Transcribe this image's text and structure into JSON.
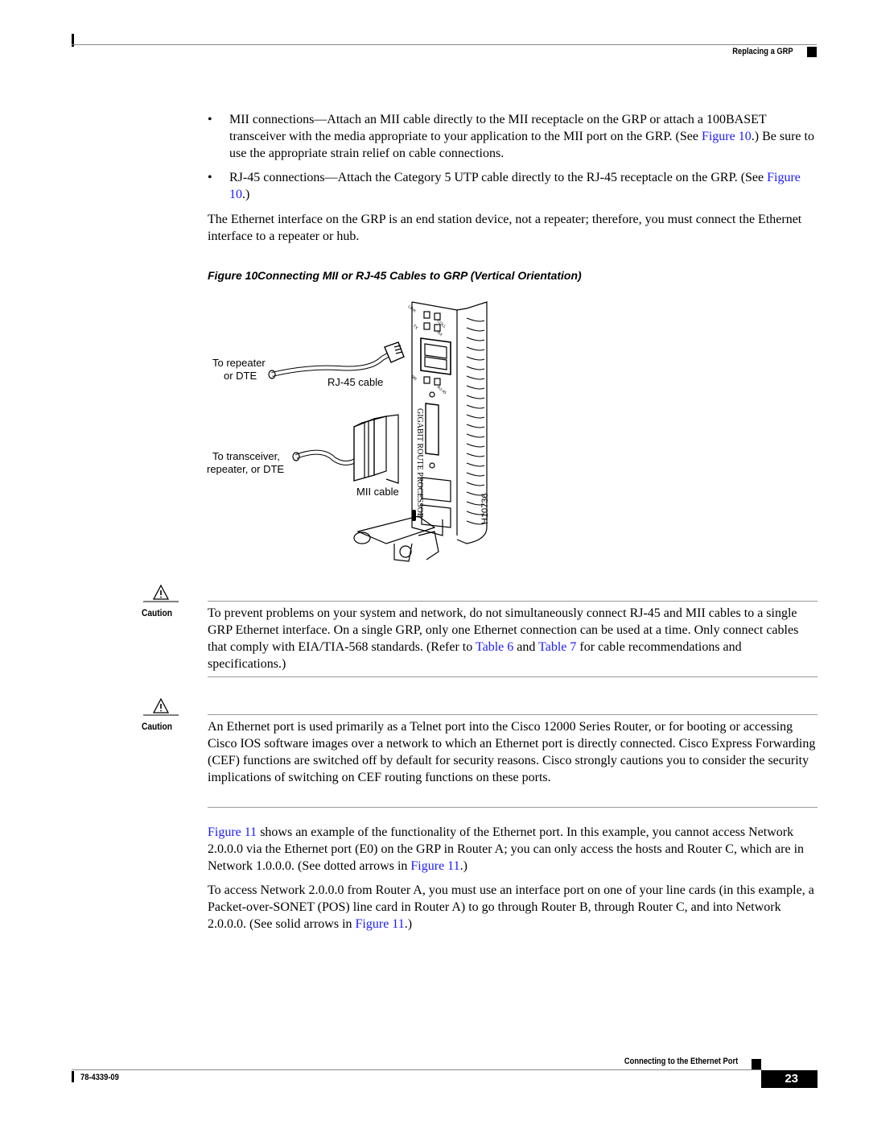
{
  "header": {
    "section_title": "Replacing a GRP"
  },
  "bullets": [
    {
      "parts": [
        {
          "text": "MII connections—Attach an MII cable directly to the MII receptacle on the GRP or attach a 100BASET transceiver with the media appropriate to your application to the MII port on the GRP. (See "
        },
        {
          "text": "Figure 10",
          "link": true
        },
        {
          "text": ".) Be sure to use the appropriate strain relief on cable connections."
        }
      ]
    },
    {
      "parts": [
        {
          "text": "RJ-45 connections—Attach the Category 5 UTP cable directly to the RJ-45 receptacle on the GRP. (See "
        },
        {
          "text": "Figure 10",
          "link": true
        },
        {
          "text": ".)"
        }
      ]
    }
  ],
  "para_ethernet": "The Ethernet interface on the GRP is an end station device, not a repeater; therefore, you must connect the Ethernet interface to a repeater or hub.",
  "figure": {
    "number": "Figure 10",
    "title": "Connecting MII or RJ-45 Cables to GRP (Vertical Orientation)",
    "labels": {
      "to_repeater_1": "To repeater",
      "to_repeater_2": "or DTE",
      "rj45_cable": "RJ-45 cable",
      "to_transceiver_1": "To transceiver,",
      "to_transceiver_2": "repeater, or DTE",
      "mii_cable": "MII cable",
      "card_name": "GIGABIT ROUTE PROCESSOR",
      "figure_id": "H10736",
      "led_link": "LINK",
      "led_coll": "COLL",
      "led_tx": "TX",
      "led_rx": "RX",
      "led_mii": "MII",
      "led_rj45": "RJ-45"
    }
  },
  "cautions": [
    {
      "label": "Caution",
      "parts": [
        {
          "text": "To prevent problems on your system and network, do not simultaneously connect RJ-45 and MII cables to a single GRP Ethernet interface. On a single GRP, only one Ethernet connection can be used at a time. Only connect cables that comply with EIA/TIA-568 standards. (Refer to "
        },
        {
          "text": "Table 6",
          "link": true
        },
        {
          "text": " and "
        },
        {
          "text": "Table 7",
          "link": true
        },
        {
          "text": " for cable recommendations and specifications.)"
        }
      ]
    },
    {
      "label": "Caution",
      "parts": [
        {
          "text": "An Ethernet port is used primarily as a Telnet port into the Cisco 12000 Series Router, or for booting or accessing Cisco IOS software images over a network to which an Ethernet port is directly connected. Cisco Express Forwarding (CEF) functions are switched off by default for security reasons. Cisco strongly cautions you to consider the security implications of switching on CEF routing functions on these ports."
        }
      ]
    }
  ],
  "para_fig11": [
    {
      "text": "Figure 11",
      "link": true
    },
    {
      "text": " shows an example of the functionality of the Ethernet port. In this example, you cannot access Network 2.0.0.0 via the Ethernet port (E0) on the GRP in Router A; you can only access the hosts and Router C, which are in Network 1.0.0.0. (See dotted arrows in "
    },
    {
      "text": "Figure 11",
      "link": true
    },
    {
      "text": ".)"
    }
  ],
  "para_access": [
    {
      "text": "To access Network 2.0.0.0 from Router A, you must use an interface port on one of your line cards (in this example, a Packet-over-SONET (POS) line card in Router A) to go through Router B, through Router C, and into Network 2.0.0.0. (See solid arrows in "
    },
    {
      "text": "Figure 11",
      "link": true
    },
    {
      "text": ".)"
    }
  ],
  "footer": {
    "section_title": "Connecting to the Ethernet Port",
    "doc_number": "78-4339-09",
    "page_number": "23"
  },
  "colors": {
    "link": "#1a1aff",
    "rule": "#888888"
  }
}
